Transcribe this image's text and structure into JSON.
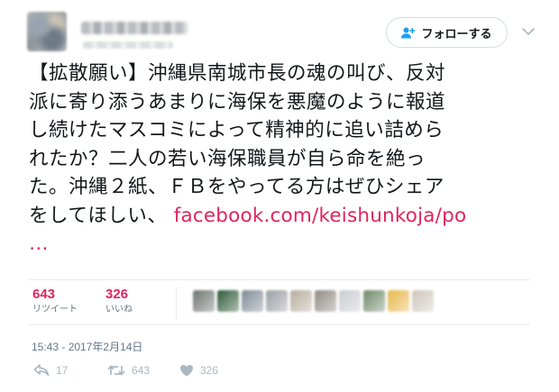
{
  "header": {
    "follow_label": "フォローする"
  },
  "tweet": {
    "lines": [
      "【拡散願い】沖縄県南城市長の魂の叫び、反対",
      "派に寄り添うあまりに海保を悪魔のように報道",
      "し続けたマスコミによって精神的に追い詰めら",
      "れたか？二人の若い海保職員が自ら命を絶っ",
      "た。沖縄２紙、ＦＢをやってる方はぜひシェア",
      "をしてほしい、"
    ],
    "link": "facebook.com/keishunkoja/po",
    "ellipsis": "…"
  },
  "stats": {
    "retweets": {
      "count": "643",
      "label": "リツイート"
    },
    "likes": {
      "count": "326",
      "label": "いいね"
    }
  },
  "liker_avatars": [
    {
      "icon": "avatar-1",
      "color": "#6d7470"
    },
    {
      "icon": "avatar-2",
      "color": "#2f5a3a"
    },
    {
      "icon": "avatar-3",
      "color": "#7f8a96"
    },
    {
      "icon": "avatar-4",
      "color": "#9a9ea3"
    },
    {
      "icon": "avatar-5",
      "color": "#b7ad9e"
    },
    {
      "icon": "avatar-6",
      "color": "#8f8a82"
    },
    {
      "icon": "avatar-7",
      "color": "#c8ccd0"
    },
    {
      "icon": "avatar-8",
      "color": "#6f8a6a"
    },
    {
      "icon": "avatar-9",
      "color": "#e7b84a"
    },
    {
      "icon": "avatar-10",
      "color": "#cfc6bc"
    }
  ],
  "timestamp": "15:43 - 2017年2月14日",
  "actions": {
    "reply": "17",
    "retweet": "643",
    "like": "326"
  },
  "colors": {
    "accent": "#e0245e",
    "muted": "#657786",
    "icon_gray": "#aab8c2",
    "follow_icon": "#1da1f2"
  }
}
